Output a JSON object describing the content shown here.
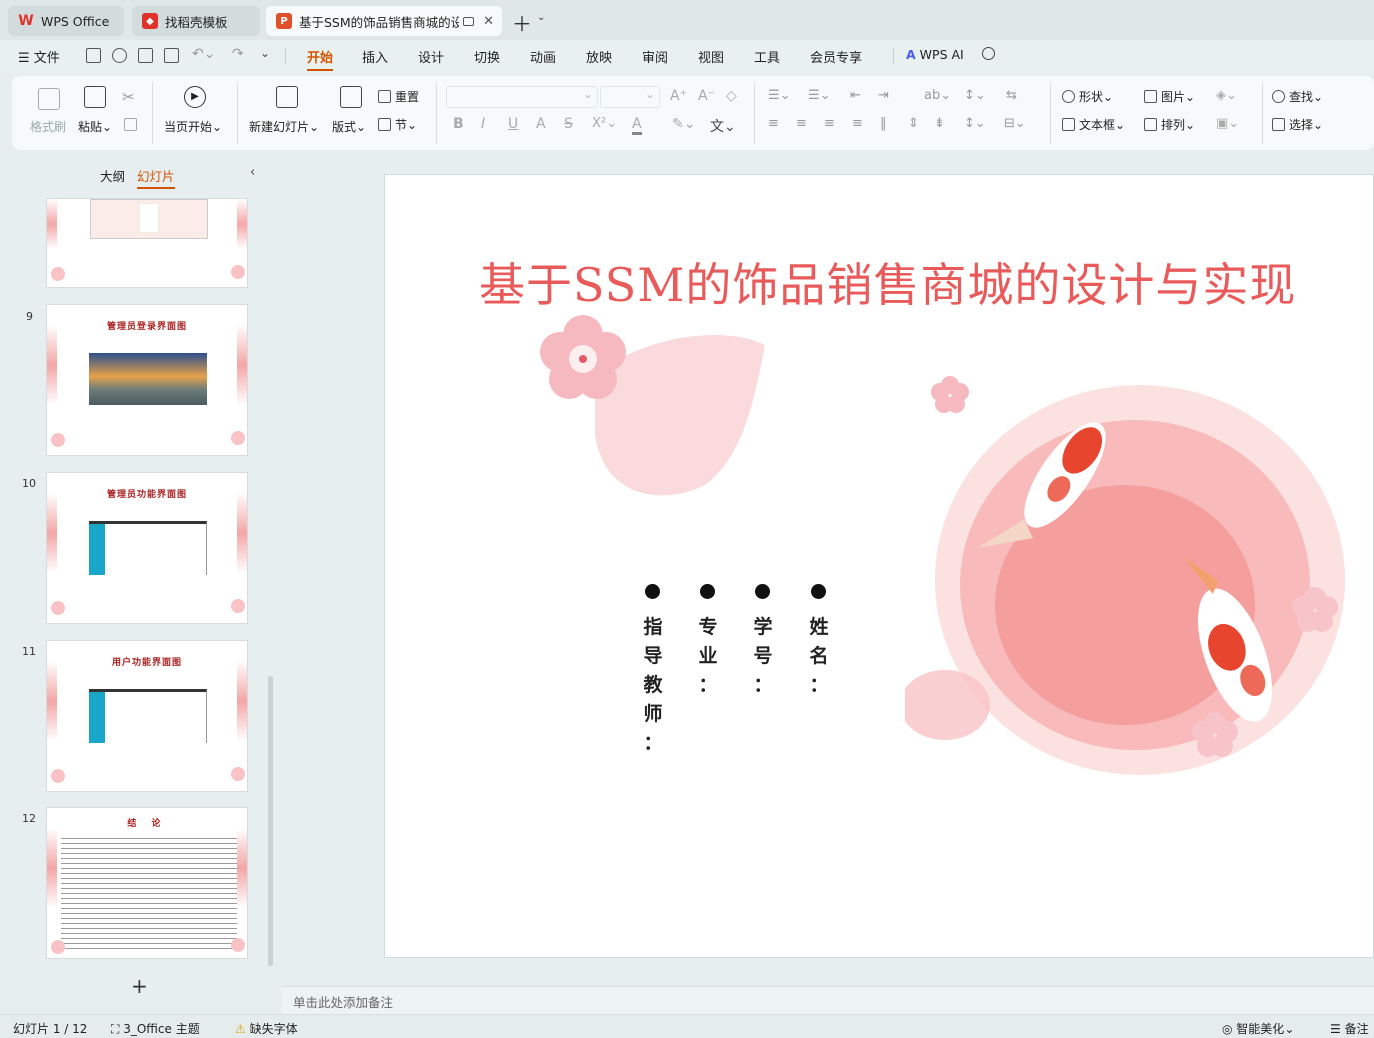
{
  "tabs": [
    {
      "label": "WPS Office",
      "icon": "wps-logo-icon"
    },
    {
      "label": "找稻壳模板",
      "icon": "docer-icon"
    },
    {
      "label": "基于SSM的饰品销售商城的设",
      "icon": "presentation-file-icon"
    }
  ],
  "menu": {
    "file": "文件",
    "items": [
      "开始",
      "插入",
      "设计",
      "切换",
      "动画",
      "放映",
      "审阅",
      "视图",
      "工具",
      "会员专享"
    ],
    "active": "开始",
    "ai": "WPS AI"
  },
  "ribbon": {
    "format_painter": "格式刷",
    "paste": "粘贴",
    "play_from_current": "当页开始",
    "new_slide": "新建幻灯片",
    "layout": "版式",
    "reset": "重置",
    "section": "节",
    "shape": "形状",
    "picture": "图片",
    "find": "查找",
    "textbox": "文本框",
    "arrange": "排列",
    "select": "选择"
  },
  "panel": {
    "tab_outline": "大纲",
    "tab_slides": "幻灯片",
    "add_slide": "+"
  },
  "thumbnails": [
    {
      "num": "",
      "title": ""
    },
    {
      "num": "9",
      "title": "管理员登录界面图"
    },
    {
      "num": "10",
      "title": "管理员功能界面图"
    },
    {
      "num": "11",
      "title": "用户功能界面图"
    },
    {
      "num": "12",
      "title": "结 论"
    }
  ],
  "slide": {
    "title": "基于SSM的饰品销售商城的设计与实现",
    "columns": [
      {
        "chars": [
          "指",
          "导",
          "教",
          "师",
          "："
        ]
      },
      {
        "chars": [
          "专",
          "业",
          "："
        ]
      },
      {
        "chars": [
          "学",
          "号",
          "："
        ]
      },
      {
        "chars": [
          "姓",
          "名",
          "："
        ]
      }
    ]
  },
  "notes_placeholder": "单击此处添加备注",
  "status": {
    "slide_counter": "幻灯片 1 / 12",
    "theme": "3_Office 主题",
    "missing_font": "缺失字体",
    "smart_beautify": "智能美化",
    "notes": "备注"
  },
  "colors": {
    "accent": "#e95a5a",
    "tab_active_menu": "#d35400",
    "wps_red": "#e0312b"
  }
}
